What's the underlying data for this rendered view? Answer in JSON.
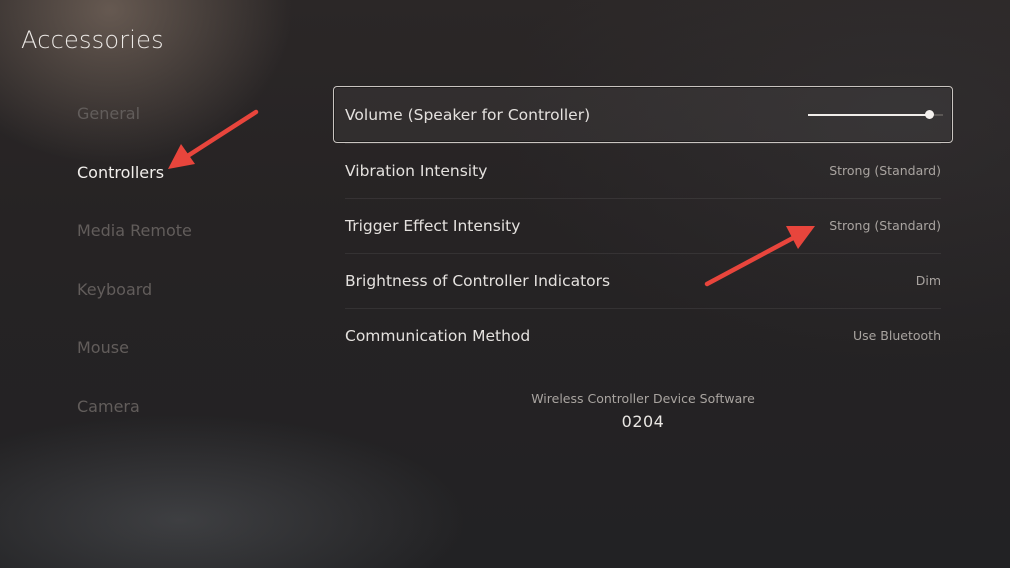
{
  "page": {
    "title": "Accessories"
  },
  "sidebar": {
    "items": [
      {
        "label": "General",
        "selected": false
      },
      {
        "label": "Controllers",
        "selected": true
      },
      {
        "label": "Media Remote",
        "selected": false
      },
      {
        "label": "Keyboard",
        "selected": false
      },
      {
        "label": "Mouse",
        "selected": false
      },
      {
        "label": "Camera",
        "selected": false
      }
    ]
  },
  "settings": {
    "volume": {
      "label": "Volume (Speaker for Controller)",
      "level": 0.9
    },
    "vibration": {
      "label": "Vibration Intensity",
      "value": "Strong (Standard)"
    },
    "trigger": {
      "label": "Trigger Effect Intensity",
      "value": "Strong (Standard)"
    },
    "brightness": {
      "label": "Brightness of Controller Indicators",
      "value": "Dim"
    },
    "communication": {
      "label": "Communication Method",
      "value": "Use Bluetooth"
    }
  },
  "software": {
    "caption": "Wireless Controller Device Software",
    "version": "0204"
  },
  "annotations": {
    "arrow_color": "#e8453c"
  },
  "colors": {
    "focus_border": "#c9c4c0",
    "text_primary": "#e4e1de",
    "text_secondary": "#a9a4a0",
    "text_dim": "#625d5b"
  }
}
